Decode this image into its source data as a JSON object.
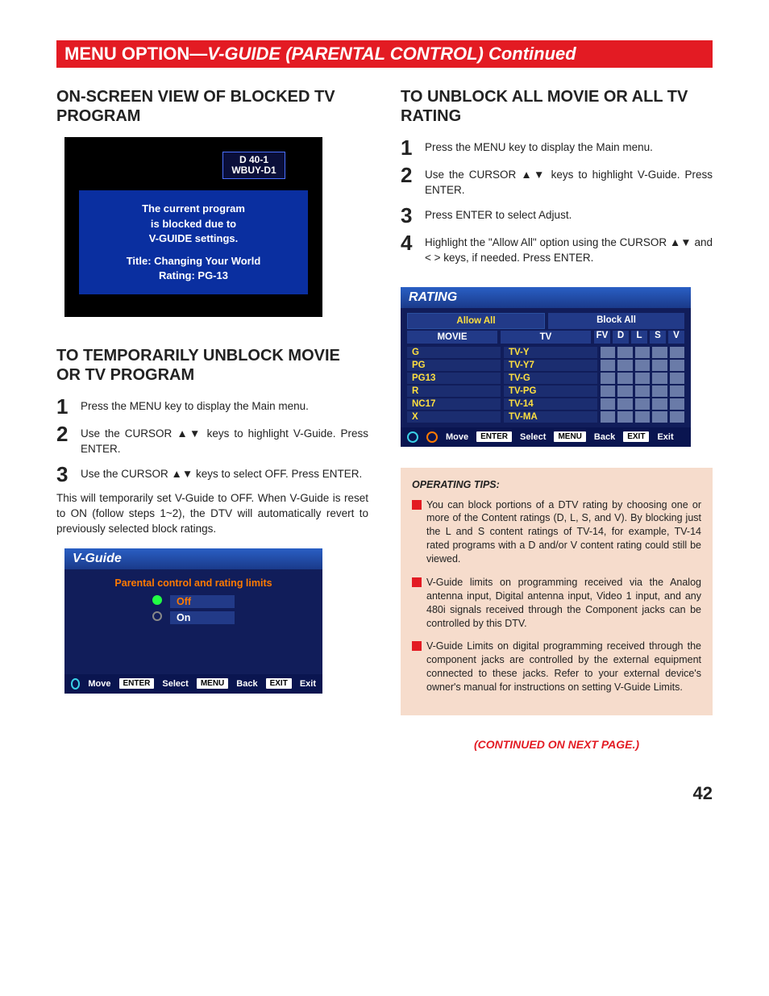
{
  "banner": {
    "prefix": "MENU OPTION—",
    "title": "V-GUIDE  (PARENTAL CONTROL) Continued"
  },
  "left": {
    "h_blocked": "ON-SCREEN VIEW OF BLOCKED TV PROGRAM",
    "tv": {
      "ch1": "D 40-1",
      "ch2": "WBUY-D1",
      "msg1": "The current program",
      "msg2": "is blocked due to",
      "msg3": "V-GUIDE settings.",
      "title_label": "Title: Changing Your World",
      "rating_label": "Rating: PG-13"
    },
    "h_temp": "TO TEMPORARILY UNBLOCK MOVIE OR TV PROGRAM",
    "steps": {
      "s1": "Press the MENU key to display the Main menu.",
      "s2": "Use the CURSOR ▲▼ keys to highlight V-Guide. Press ENTER.",
      "s3": "Use the CURSOR ▲▼ keys to select OFF. Press ENTER."
    },
    "para": "This will temporarily set V-Guide to OFF. When V-Guide is reset to ON (follow steps 1~2), the DTV will automatically revert to previously selected block ratings.",
    "vguide": {
      "title": "V-Guide",
      "sub": "Parental control and rating limits",
      "off": "Off",
      "on": "On",
      "nav": {
        "move": "Move",
        "enter": "ENTER",
        "select": "Select",
        "menu": "MENU",
        "back": "Back",
        "exit_btn": "EXIT",
        "exit": "Exit"
      }
    }
  },
  "right": {
    "h_unblock": "TO UNBLOCK ALL MOVIE OR ALL TV RATING",
    "steps": {
      "s1": "Press the MENU key to display the Main menu.",
      "s2": "Use the CURSOR ▲▼ keys to highlight V-Guide. Press ENTER.",
      "s3": "Press ENTER to select Adjust.",
      "s4": "Highlight the \"Allow All\" option using the CURSOR ▲▼ and < > keys, if needed. Press ENTER."
    },
    "rating": {
      "title": "RATING",
      "allow": "Allow All",
      "block": "Block All",
      "col_movie": "MOVIE",
      "col_tv": "TV",
      "fv": "FV",
      "d": "D",
      "l": "L",
      "s": "S",
      "v": "V",
      "movie": [
        "G",
        "PG",
        "PG13",
        "R",
        "NC17",
        "X"
      ],
      "tv": [
        "TV-Y",
        "TV-Y7",
        "TV-G",
        "TV-PG",
        "TV-14",
        "TV-MA"
      ],
      "nav": {
        "move": "Move",
        "enter": "ENTER",
        "select": "Select",
        "menu": "MENU",
        "back": "Back",
        "exit_btn": "EXIT",
        "exit": "Exit"
      }
    },
    "tips_title": "OPERATING TIPS:",
    "tips": {
      "t1": "You can block portions of a DTV rating by choosing one or more of the Content ratings (D, L, S, and V). By blocking just the L and S content ratings of TV-14, for example, TV-14 rated programs with a D and/or V content rating could still be viewed.",
      "t2": "V-Guide limits on programming received via the Analog antenna input, Digital antenna input, Video 1 input, and any 480i signals received through the Component jacks can be controlled by this DTV.",
      "t3": "V-Guide Limits on digital programming received through the component jacks are controlled by the external equipment connected to these jacks. Refer to your external device's owner's manual for instructions on setting V-Guide Limits."
    },
    "continued": "(CONTINUED ON NEXT PAGE.)"
  },
  "page": "42"
}
